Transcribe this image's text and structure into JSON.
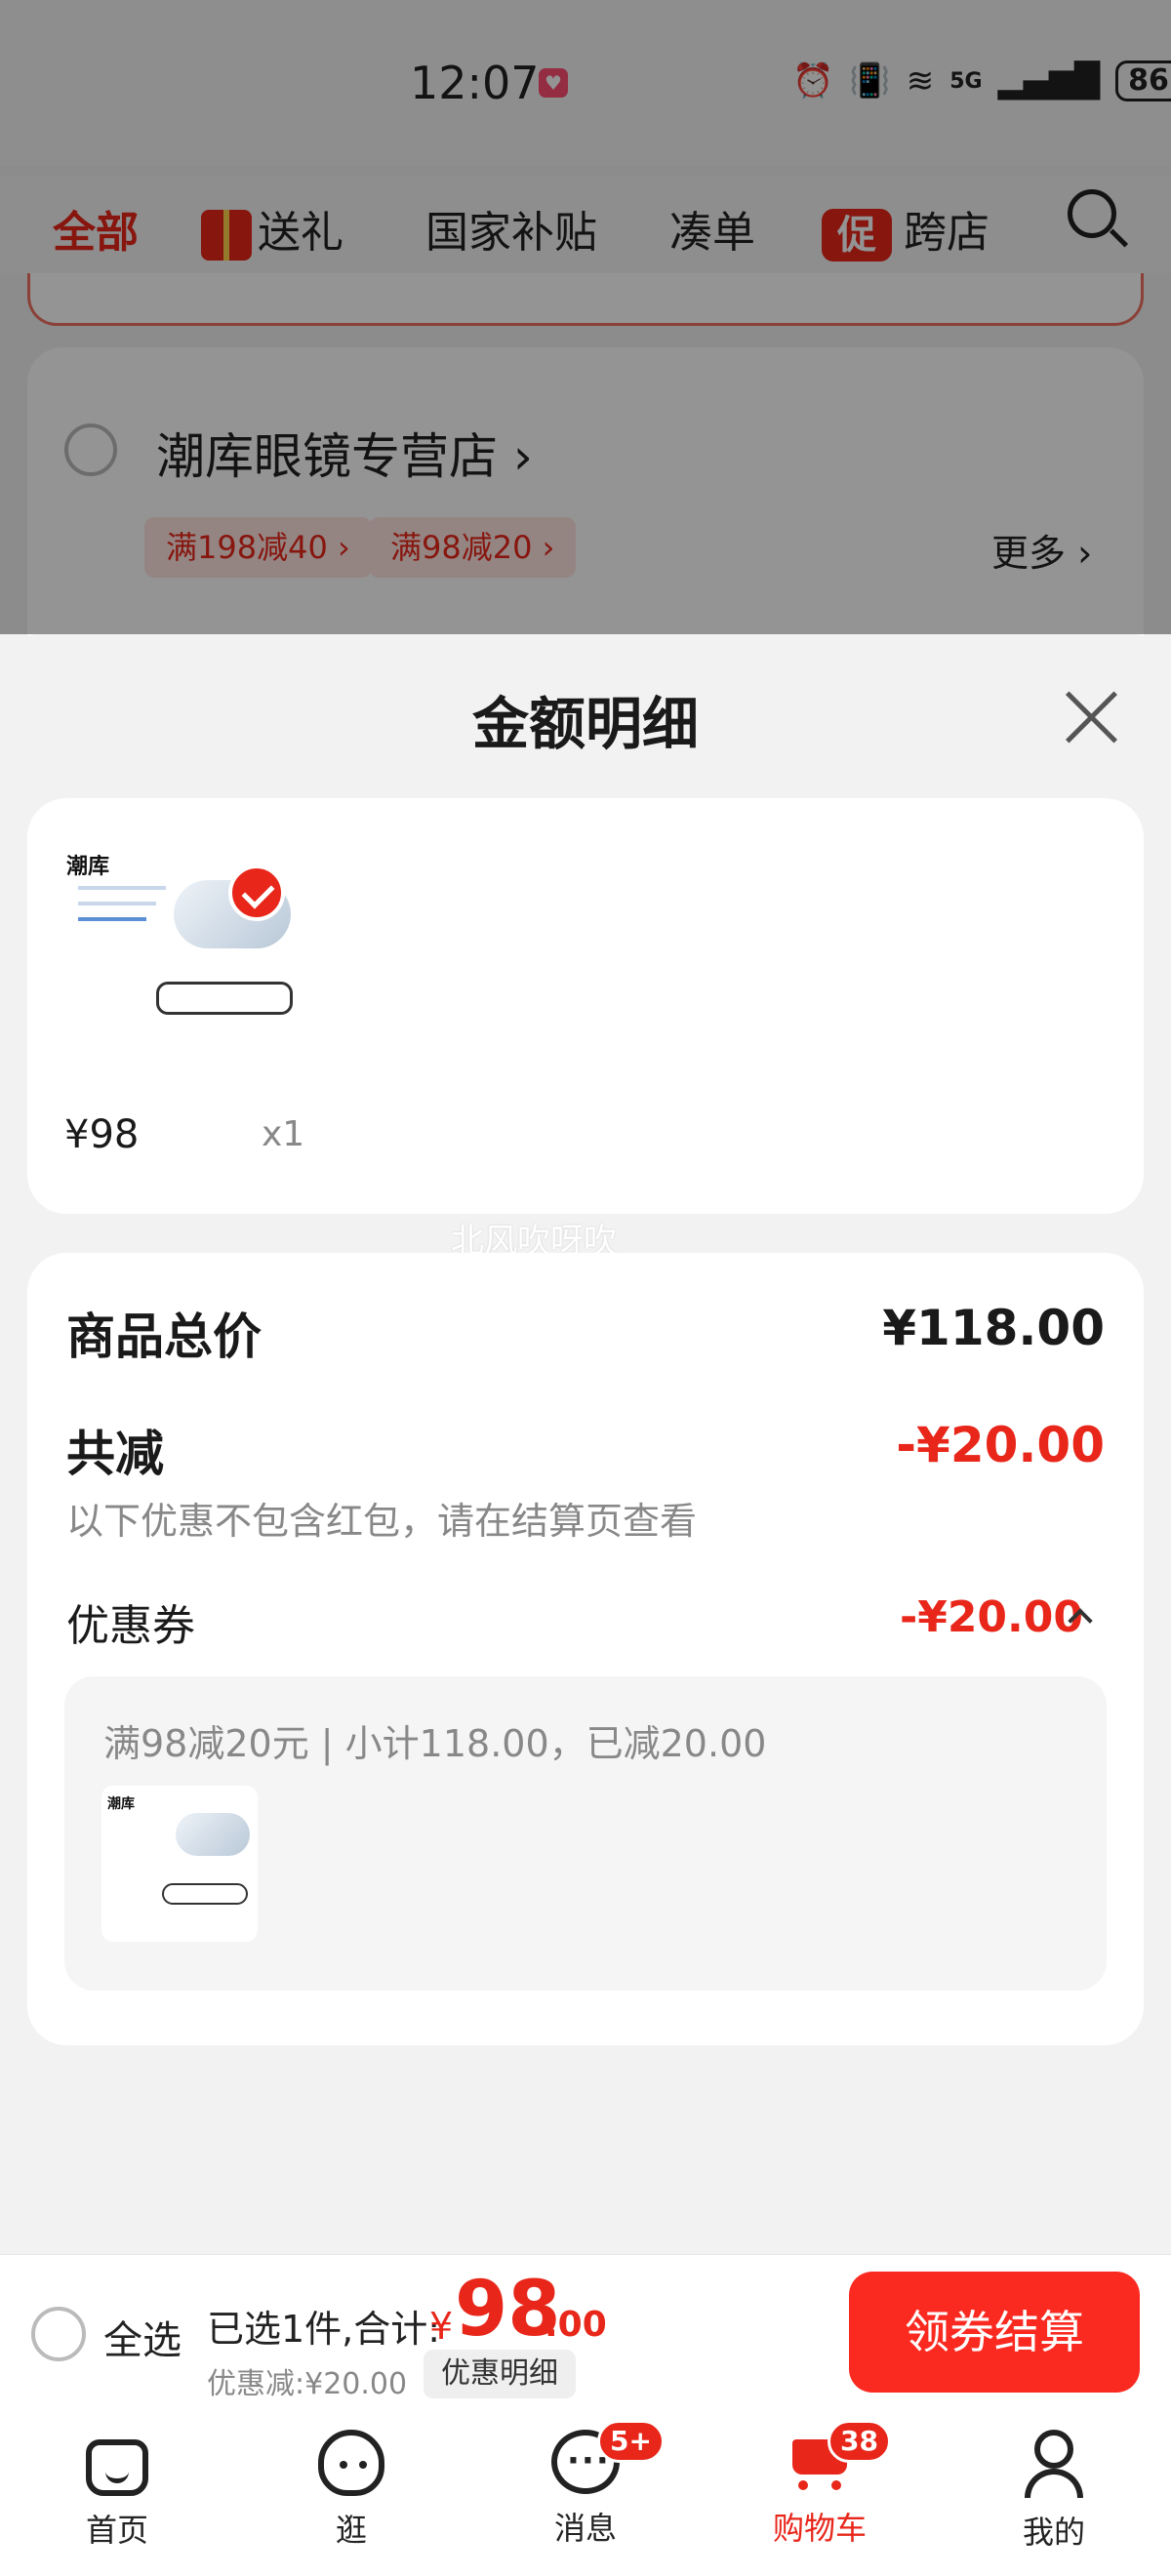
{
  "status_bar": {
    "time": "12:07",
    "network": "5G",
    "battery": "86"
  },
  "top_tabs": [
    "全部",
    "送礼",
    "国家补贴",
    "凑单",
    "跨店"
  ],
  "promo_badge": "促",
  "store": {
    "name": "潮库眼镜专营店",
    "coupons": [
      "满198减40",
      "满98减20"
    ],
    "more": "更多"
  },
  "sheet": {
    "title": "金额明细",
    "item": {
      "brand": "潮库",
      "price": "¥98",
      "qty": "x1"
    },
    "watermark": "北风吹呀吹",
    "summary": {
      "total_label": "商品总价",
      "total_value": "¥118.00",
      "reduce_label": "共减",
      "reduce_value": "-¥20.00",
      "note": "以下优惠不包含红包，请在结算页查看",
      "coupon_label": "优惠券",
      "coupon_value": "-¥20.00",
      "coupon_desc": "满98减20元 | 小计118.00，已减20.00"
    }
  },
  "checkout": {
    "select_all": "全选",
    "selected_text": "已选1件,合计:",
    "currency": "¥",
    "total_int": "98",
    "total_dec": ".00",
    "discount_text": "优惠减:¥20.00",
    "detail_button": "优惠明细",
    "checkout_button": "领券结算"
  },
  "bottom_nav": [
    {
      "label": "首页",
      "icon": "home-icon"
    },
    {
      "label": "逛",
      "icon": "stroll-icon"
    },
    {
      "label": "消息",
      "icon": "message-icon",
      "badge": "5+"
    },
    {
      "label": "购物车",
      "icon": "cart-icon",
      "badge": "38",
      "active": true
    },
    {
      "label": "我的",
      "icon": "profile-icon"
    }
  ],
  "colors": {
    "accent": "#e8261a",
    "checkout_button": "#fb2a21",
    "overlay": "rgba(0,0,0,0.42)"
  }
}
